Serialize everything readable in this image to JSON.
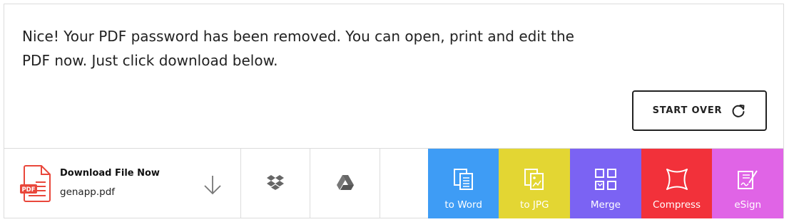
{
  "message": {
    "line1": "Nice! Your PDF password has been removed. You can open, print and edit the",
    "line2": "PDF now. Just click download below."
  },
  "start_over": {
    "label": "START OVER",
    "icon": "refresh-icon"
  },
  "download": {
    "title": "Download File Now",
    "filename": "genapp.pdf",
    "file_icon": "pdf-file-icon",
    "file_icon_badge": "PDF",
    "arrow_icon": "download-arrow-icon"
  },
  "services": [
    {
      "name": "dropbox",
      "icon": "dropbox-icon"
    },
    {
      "name": "google-drive",
      "icon": "google-drive-icon"
    },
    {
      "name": "more",
      "icon": ""
    }
  ],
  "tools": [
    {
      "label": "to Word",
      "icon": "word-document-icon",
      "color": "#3e9cf5"
    },
    {
      "label": "to JPG",
      "icon": "jpg-document-icon",
      "color": "#e3d633"
    },
    {
      "label": "Merge",
      "icon": "merge-icon",
      "color": "#7b63f3"
    },
    {
      "label": "Compress",
      "icon": "compress-icon",
      "color": "#f2313a"
    },
    {
      "label": "eSign",
      "icon": "esign-icon",
      "color": "#e064e6"
    }
  ],
  "colors": {
    "pdf_red": "#e9473b",
    "border": "#dcdcdc",
    "icon_gray": "#666666"
  }
}
